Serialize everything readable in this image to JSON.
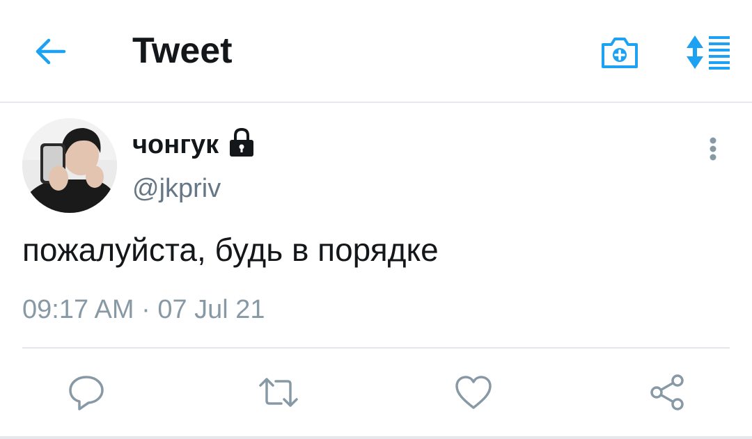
{
  "header": {
    "title": "Tweet"
  },
  "tweet": {
    "display_name": "чонгук",
    "handle": "@jkpriv",
    "text": "пожалуйста, будь в порядке",
    "timestamp": "09:17 AM · 07 Jul 21"
  },
  "colors": {
    "accent": "#1da1f2",
    "text": "#14171a",
    "muted": "#657786",
    "icon_gray": "#8899a6"
  },
  "icons": {
    "back": "arrow-left-icon",
    "camera": "camera-plus-icon",
    "sort": "sort-list-icon",
    "lock": "lock-icon",
    "more": "more-vertical-icon",
    "reply": "reply-icon",
    "retweet": "retweet-icon",
    "like": "heart-icon",
    "share": "share-icon"
  }
}
